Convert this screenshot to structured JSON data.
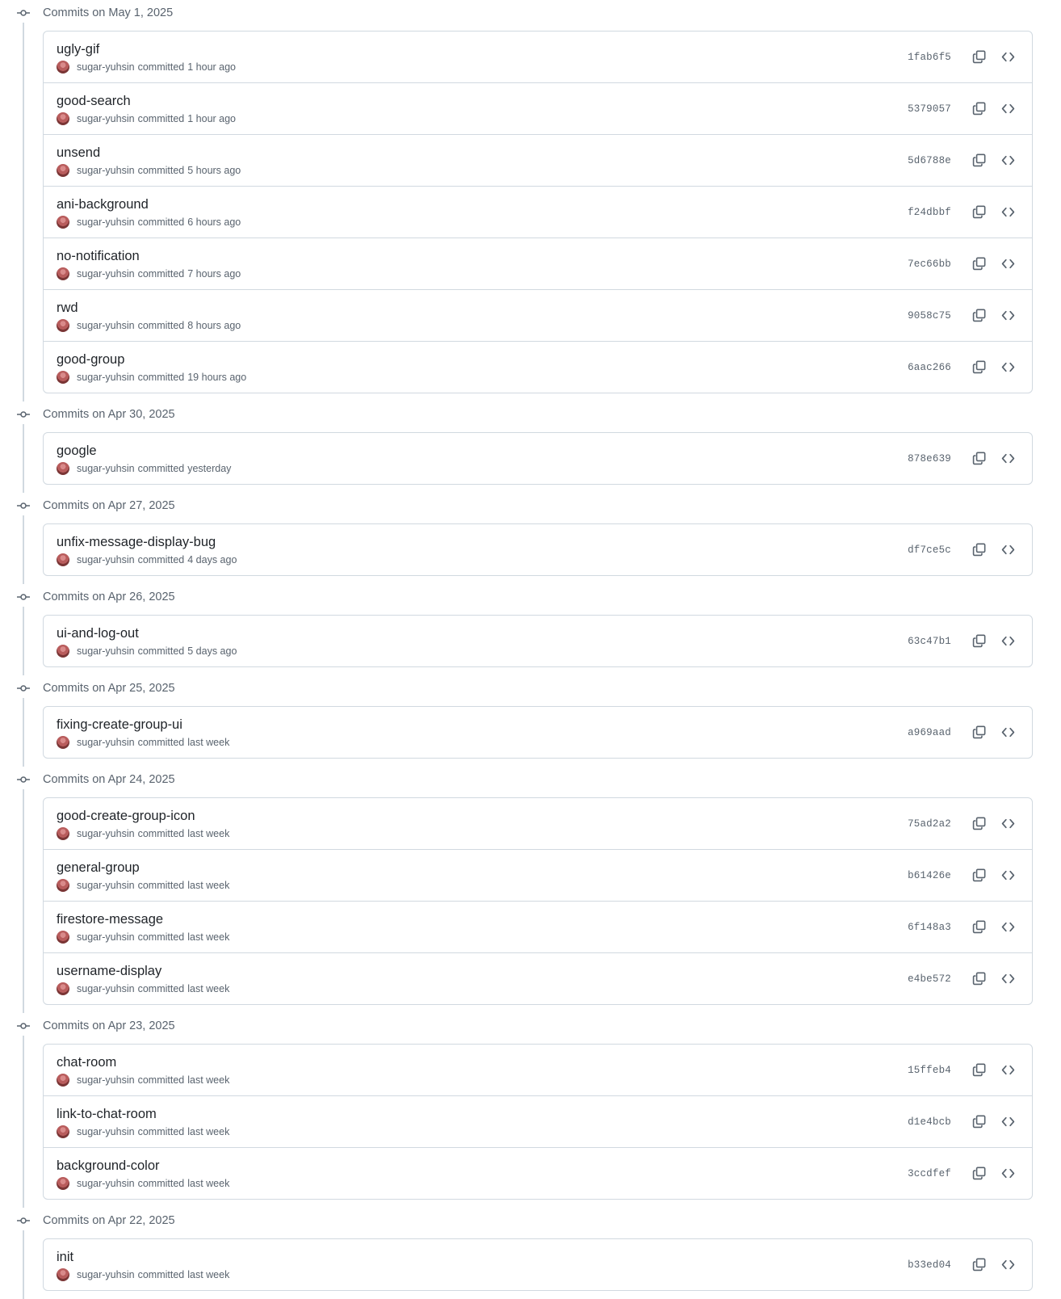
{
  "groups": [
    {
      "title": "Commits on May 1, 2025",
      "commits": [
        {
          "message": "ugly-gif",
          "author": "sugar-yuhsin",
          "verb": "committed",
          "time": "1 hour ago",
          "sha": "1fab6f5"
        },
        {
          "message": "good-search",
          "author": "sugar-yuhsin",
          "verb": "committed",
          "time": "1 hour ago",
          "sha": "5379057"
        },
        {
          "message": "unsend",
          "author": "sugar-yuhsin",
          "verb": "committed",
          "time": "5 hours ago",
          "sha": "5d6788e"
        },
        {
          "message": "ani-background",
          "author": "sugar-yuhsin",
          "verb": "committed",
          "time": "6 hours ago",
          "sha": "f24dbbf"
        },
        {
          "message": "no-notification",
          "author": "sugar-yuhsin",
          "verb": "committed",
          "time": "7 hours ago",
          "sha": "7ec66bb"
        },
        {
          "message": "rwd",
          "author": "sugar-yuhsin",
          "verb": "committed",
          "time": "8 hours ago",
          "sha": "9058c75"
        },
        {
          "message": "good-group",
          "author": "sugar-yuhsin",
          "verb": "committed",
          "time": "19 hours ago",
          "sha": "6aac266"
        }
      ]
    },
    {
      "title": "Commits on Apr 30, 2025",
      "commits": [
        {
          "message": "google",
          "author": "sugar-yuhsin",
          "verb": "committed",
          "time": "yesterday",
          "sha": "878e639"
        }
      ]
    },
    {
      "title": "Commits on Apr 27, 2025",
      "commits": [
        {
          "message": "unfix-message-display-bug",
          "author": "sugar-yuhsin",
          "verb": "committed",
          "time": "4 days ago",
          "sha": "df7ce5c"
        }
      ]
    },
    {
      "title": "Commits on Apr 26, 2025",
      "commits": [
        {
          "message": "ui-and-log-out",
          "author": "sugar-yuhsin",
          "verb": "committed",
          "time": "5 days ago",
          "sha": "63c47b1"
        }
      ]
    },
    {
      "title": "Commits on Apr 25, 2025",
      "commits": [
        {
          "message": "fixing-create-group-ui",
          "author": "sugar-yuhsin",
          "verb": "committed",
          "time": "last week",
          "sha": "a969aad"
        }
      ]
    },
    {
      "title": "Commits on Apr 24, 2025",
      "commits": [
        {
          "message": "good-create-group-icon",
          "author": "sugar-yuhsin",
          "verb": "committed",
          "time": "last week",
          "sha": "75ad2a2"
        },
        {
          "message": "general-group",
          "author": "sugar-yuhsin",
          "verb": "committed",
          "time": "last week",
          "sha": "b61426e"
        },
        {
          "message": "firestore-message",
          "author": "sugar-yuhsin",
          "verb": "committed",
          "time": "last week",
          "sha": "6f148a3"
        },
        {
          "message": "username-display",
          "author": "sugar-yuhsin",
          "verb": "committed",
          "time": "last week",
          "sha": "e4be572"
        }
      ]
    },
    {
      "title": "Commits on Apr 23, 2025",
      "commits": [
        {
          "message": "chat-room",
          "author": "sugar-yuhsin",
          "verb": "committed",
          "time": "last week",
          "sha": "15ffeb4"
        },
        {
          "message": "link-to-chat-room",
          "author": "sugar-yuhsin",
          "verb": "committed",
          "time": "last week",
          "sha": "d1e4bcb"
        },
        {
          "message": "background-color",
          "author": "sugar-yuhsin",
          "verb": "committed",
          "time": "last week",
          "sha": "3ccdfef"
        }
      ]
    },
    {
      "title": "Commits on Apr 22, 2025",
      "commits": [
        {
          "message": "init",
          "author": "sugar-yuhsin",
          "verb": "committed",
          "time": "last week",
          "sha": "b33ed04"
        }
      ]
    }
  ],
  "icons": {
    "group_marker": "git-commit-icon",
    "copy": "copy-icon",
    "browse": "code-icon"
  },
  "colors": {
    "border": "#d1d9e0",
    "muted_text": "#59636e",
    "primary_text": "#1f2328"
  }
}
